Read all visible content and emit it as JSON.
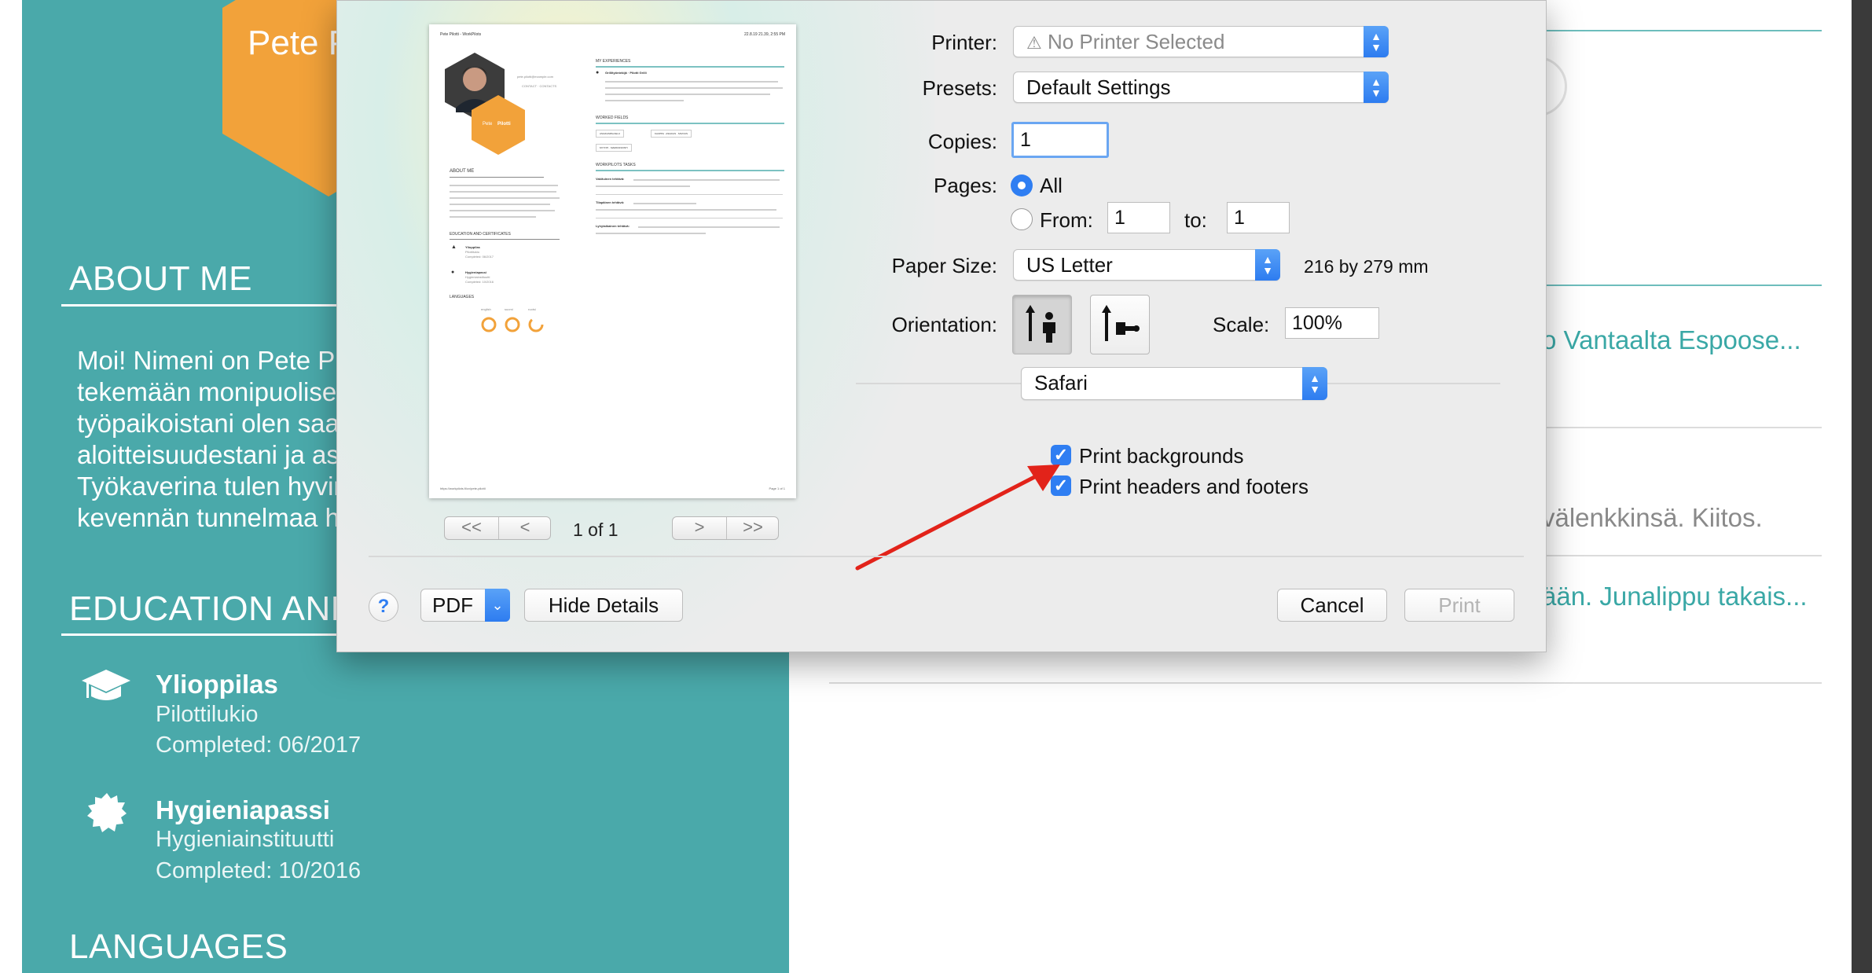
{
  "resume": {
    "hex_name": "Pete P",
    "about_heading": "ABOUT ME",
    "about_lines": [
      "Moi! Nimeni on Pete Pi",
      "tekemään monipuolise",
      "työpaikoistani olen saa",
      "aloitteisuudestani ja as",
      "Työkaverina tulen hyvir",
      "kevennän tunnelmaa h"
    ],
    "education_heading": "EDUCATION AND",
    "certs": [
      {
        "title": "Ylioppilas",
        "org": "Pilottilukio",
        "completed": "Completed: 06/2017",
        "icon": "graduation-cap-icon"
      },
      {
        "title": "Hygieniapassi",
        "org": "Hygieniainstituutti",
        "completed": "Completed: 10/2016",
        "icon": "badge-seal-icon"
      }
    ],
    "languages_heading": "LANGUAGES",
    "right_snippets": {
      "vantaa": "o Vantaalta Espoose...",
      "kiitos": "välenkkinsä. Kiitos.",
      "junalippu": "ään. Junalippu takais..."
    },
    "colors": {
      "panel": "#4aa9aa",
      "hex": "#f2a23a",
      "link": "#3aa8a6"
    }
  },
  "dialog": {
    "preview": {
      "header_left": "Pete Pilotti - WorkPilots",
      "header_right": "22.8.19 21.39, 2:55 PM",
      "card_name_first": "Pete",
      "card_name_last": "Pilotti",
      "contact_lines": [
        "pete.pilotti@example.com",
        "CONTACT · CONTACTS"
      ],
      "about_title": "ABOUT ME",
      "education_title": "EDUCATION AND CERTIFICATES",
      "edu_items": [
        {
          "title": "Ylioppilas",
          "sub": "Pilottilukio",
          "date": "Completed: 06/2017"
        },
        {
          "title": "Hygieniapassi",
          "sub": "Hygieniainstituutti",
          "date": "Completed: 10/2016"
        }
      ],
      "languages_title": "LANGUAGES",
      "language_labels": [
        "english",
        "suomi",
        "ruotsi"
      ],
      "experiences_title": "MY EXPERIENCES",
      "experience_item": "Grillityöntekijä · Pilotti Grilli",
      "worked_fields_title": "WORKED FIELDS",
      "field_tags": [
        "ASIAKASPALVELU",
        "KAUPPA · ASIAKAS · SIIVOUS",
        "MYYNTI · MARKKINOINTI"
      ],
      "tasks_title": "WORKPILOTS TASKS",
      "task_labels": [
        "Vakituinen tehtävä:",
        "Tilapäinen tehtävä:",
        "Lyhytaikainen tehtävä:"
      ],
      "footer_url": "https://workpilots.fi/cv/pete-pilotti",
      "footer_page": "Page 1 of 1"
    },
    "page_nav": {
      "first": "<<",
      "prev": "<",
      "count": "1 of 1",
      "next": ">",
      "last": ">>"
    },
    "printer": {
      "label": "Printer:",
      "value": "No Printer Selected",
      "icon": "warning-triangle-icon"
    },
    "presets": {
      "label": "Presets:",
      "value": "Default Settings"
    },
    "copies": {
      "label": "Copies:",
      "value": "1"
    },
    "pages": {
      "label": "Pages:",
      "all_label": "All",
      "from_label": "From:",
      "from_value": "1",
      "to_label": "to:",
      "to_value": "1",
      "selected": "All"
    },
    "paper_size": {
      "label": "Paper Size:",
      "value": "US Letter",
      "dimensions": "216 by 279 mm"
    },
    "orientation": {
      "label": "Orientation:",
      "selected": "portrait",
      "options": [
        "portrait-icon",
        "landscape-icon"
      ]
    },
    "scale": {
      "label": "Scale:",
      "value": "100%"
    },
    "app_section": {
      "value": "Safari"
    },
    "checkboxes": [
      {
        "label": "Print backgrounds",
        "checked": true
      },
      {
        "label": "Print headers and footers",
        "checked": true
      }
    ],
    "help_label": "?",
    "pdf_label": "PDF",
    "hide_details_label": "Hide Details",
    "cancel_label": "Cancel",
    "print_label": "Print",
    "colors": {
      "accent": "#2f7ef2",
      "annotation_arrow": "#e2231a"
    }
  }
}
